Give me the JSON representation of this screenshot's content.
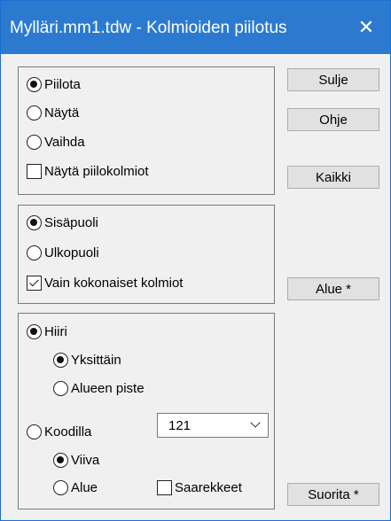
{
  "window": {
    "title": "Mylläri.mm1.tdw - Kolmioiden piilotus",
    "close_glyph": "✕"
  },
  "group_mode": {
    "options": [
      {
        "label": "Piilota",
        "selected": true
      },
      {
        "label": "Näytä",
        "selected": false
      },
      {
        "label": "Vaihda",
        "selected": false
      }
    ],
    "show_hidden": {
      "label": "Näytä piilokolmiot",
      "checked": false
    }
  },
  "group_side": {
    "options": [
      {
        "label": "Sisäpuoli",
        "selected": true
      },
      {
        "label": "Ulkopuoli",
        "selected": false
      }
    ],
    "whole_only": {
      "label": "Vain kokonaiset kolmiot",
      "checked": true
    }
  },
  "group_select": {
    "mouse": {
      "label": "Hiiri",
      "selected": true
    },
    "mouse_sub": [
      {
        "label": "Yksittäin",
        "selected": true
      },
      {
        "label": "Alueen piste",
        "selected": false
      }
    ],
    "by_code": {
      "label": "Koodilla",
      "selected": false
    },
    "code_value": "121",
    "code_sub": [
      {
        "label": "Viiva",
        "selected": true
      },
      {
        "label": "Alue",
        "selected": false
      }
    ],
    "islands": {
      "label": "Saarekkeet",
      "checked": false
    }
  },
  "buttons": {
    "close": "Sulje",
    "help": "Ohje",
    "all": "Kaikki",
    "area": "Alue *",
    "run": "Suorita *"
  }
}
